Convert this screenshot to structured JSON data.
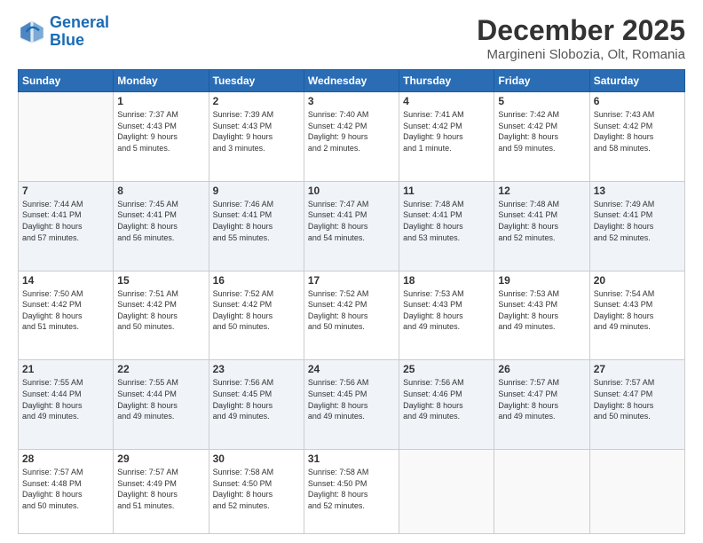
{
  "logo": {
    "line1": "General",
    "line2": "Blue"
  },
  "title": {
    "month_year": "December 2025",
    "location": "Margineni Slobozia, Olt, Romania"
  },
  "days_of_week": [
    "Sunday",
    "Monday",
    "Tuesday",
    "Wednesday",
    "Thursday",
    "Friday",
    "Saturday"
  ],
  "weeks": [
    [
      {
        "day": "",
        "info": ""
      },
      {
        "day": "1",
        "info": "Sunrise: 7:37 AM\nSunset: 4:43 PM\nDaylight: 9 hours\nand 5 minutes."
      },
      {
        "day": "2",
        "info": "Sunrise: 7:39 AM\nSunset: 4:43 PM\nDaylight: 9 hours\nand 3 minutes."
      },
      {
        "day": "3",
        "info": "Sunrise: 7:40 AM\nSunset: 4:42 PM\nDaylight: 9 hours\nand 2 minutes."
      },
      {
        "day": "4",
        "info": "Sunrise: 7:41 AM\nSunset: 4:42 PM\nDaylight: 9 hours\nand 1 minute."
      },
      {
        "day": "5",
        "info": "Sunrise: 7:42 AM\nSunset: 4:42 PM\nDaylight: 8 hours\nand 59 minutes."
      },
      {
        "day": "6",
        "info": "Sunrise: 7:43 AM\nSunset: 4:42 PM\nDaylight: 8 hours\nand 58 minutes."
      }
    ],
    [
      {
        "day": "7",
        "info": "Sunrise: 7:44 AM\nSunset: 4:41 PM\nDaylight: 8 hours\nand 57 minutes."
      },
      {
        "day": "8",
        "info": "Sunrise: 7:45 AM\nSunset: 4:41 PM\nDaylight: 8 hours\nand 56 minutes."
      },
      {
        "day": "9",
        "info": "Sunrise: 7:46 AM\nSunset: 4:41 PM\nDaylight: 8 hours\nand 55 minutes."
      },
      {
        "day": "10",
        "info": "Sunrise: 7:47 AM\nSunset: 4:41 PM\nDaylight: 8 hours\nand 54 minutes."
      },
      {
        "day": "11",
        "info": "Sunrise: 7:48 AM\nSunset: 4:41 PM\nDaylight: 8 hours\nand 53 minutes."
      },
      {
        "day": "12",
        "info": "Sunrise: 7:48 AM\nSunset: 4:41 PM\nDaylight: 8 hours\nand 52 minutes."
      },
      {
        "day": "13",
        "info": "Sunrise: 7:49 AM\nSunset: 4:41 PM\nDaylight: 8 hours\nand 52 minutes."
      }
    ],
    [
      {
        "day": "14",
        "info": "Sunrise: 7:50 AM\nSunset: 4:42 PM\nDaylight: 8 hours\nand 51 minutes."
      },
      {
        "day": "15",
        "info": "Sunrise: 7:51 AM\nSunset: 4:42 PM\nDaylight: 8 hours\nand 50 minutes."
      },
      {
        "day": "16",
        "info": "Sunrise: 7:52 AM\nSunset: 4:42 PM\nDaylight: 8 hours\nand 50 minutes."
      },
      {
        "day": "17",
        "info": "Sunrise: 7:52 AM\nSunset: 4:42 PM\nDaylight: 8 hours\nand 50 minutes."
      },
      {
        "day": "18",
        "info": "Sunrise: 7:53 AM\nSunset: 4:43 PM\nDaylight: 8 hours\nand 49 minutes."
      },
      {
        "day": "19",
        "info": "Sunrise: 7:53 AM\nSunset: 4:43 PM\nDaylight: 8 hours\nand 49 minutes."
      },
      {
        "day": "20",
        "info": "Sunrise: 7:54 AM\nSunset: 4:43 PM\nDaylight: 8 hours\nand 49 minutes."
      }
    ],
    [
      {
        "day": "21",
        "info": "Sunrise: 7:55 AM\nSunset: 4:44 PM\nDaylight: 8 hours\nand 49 minutes."
      },
      {
        "day": "22",
        "info": "Sunrise: 7:55 AM\nSunset: 4:44 PM\nDaylight: 8 hours\nand 49 minutes."
      },
      {
        "day": "23",
        "info": "Sunrise: 7:56 AM\nSunset: 4:45 PM\nDaylight: 8 hours\nand 49 minutes."
      },
      {
        "day": "24",
        "info": "Sunrise: 7:56 AM\nSunset: 4:45 PM\nDaylight: 8 hours\nand 49 minutes."
      },
      {
        "day": "25",
        "info": "Sunrise: 7:56 AM\nSunset: 4:46 PM\nDaylight: 8 hours\nand 49 minutes."
      },
      {
        "day": "26",
        "info": "Sunrise: 7:57 AM\nSunset: 4:47 PM\nDaylight: 8 hours\nand 49 minutes."
      },
      {
        "day": "27",
        "info": "Sunrise: 7:57 AM\nSunset: 4:47 PM\nDaylight: 8 hours\nand 50 minutes."
      }
    ],
    [
      {
        "day": "28",
        "info": "Sunrise: 7:57 AM\nSunset: 4:48 PM\nDaylight: 8 hours\nand 50 minutes."
      },
      {
        "day": "29",
        "info": "Sunrise: 7:57 AM\nSunset: 4:49 PM\nDaylight: 8 hours\nand 51 minutes."
      },
      {
        "day": "30",
        "info": "Sunrise: 7:58 AM\nSunset: 4:50 PM\nDaylight: 8 hours\nand 52 minutes."
      },
      {
        "day": "31",
        "info": "Sunrise: 7:58 AM\nSunset: 4:50 PM\nDaylight: 8 hours\nand 52 minutes."
      },
      {
        "day": "",
        "info": ""
      },
      {
        "day": "",
        "info": ""
      },
      {
        "day": "",
        "info": ""
      }
    ]
  ]
}
